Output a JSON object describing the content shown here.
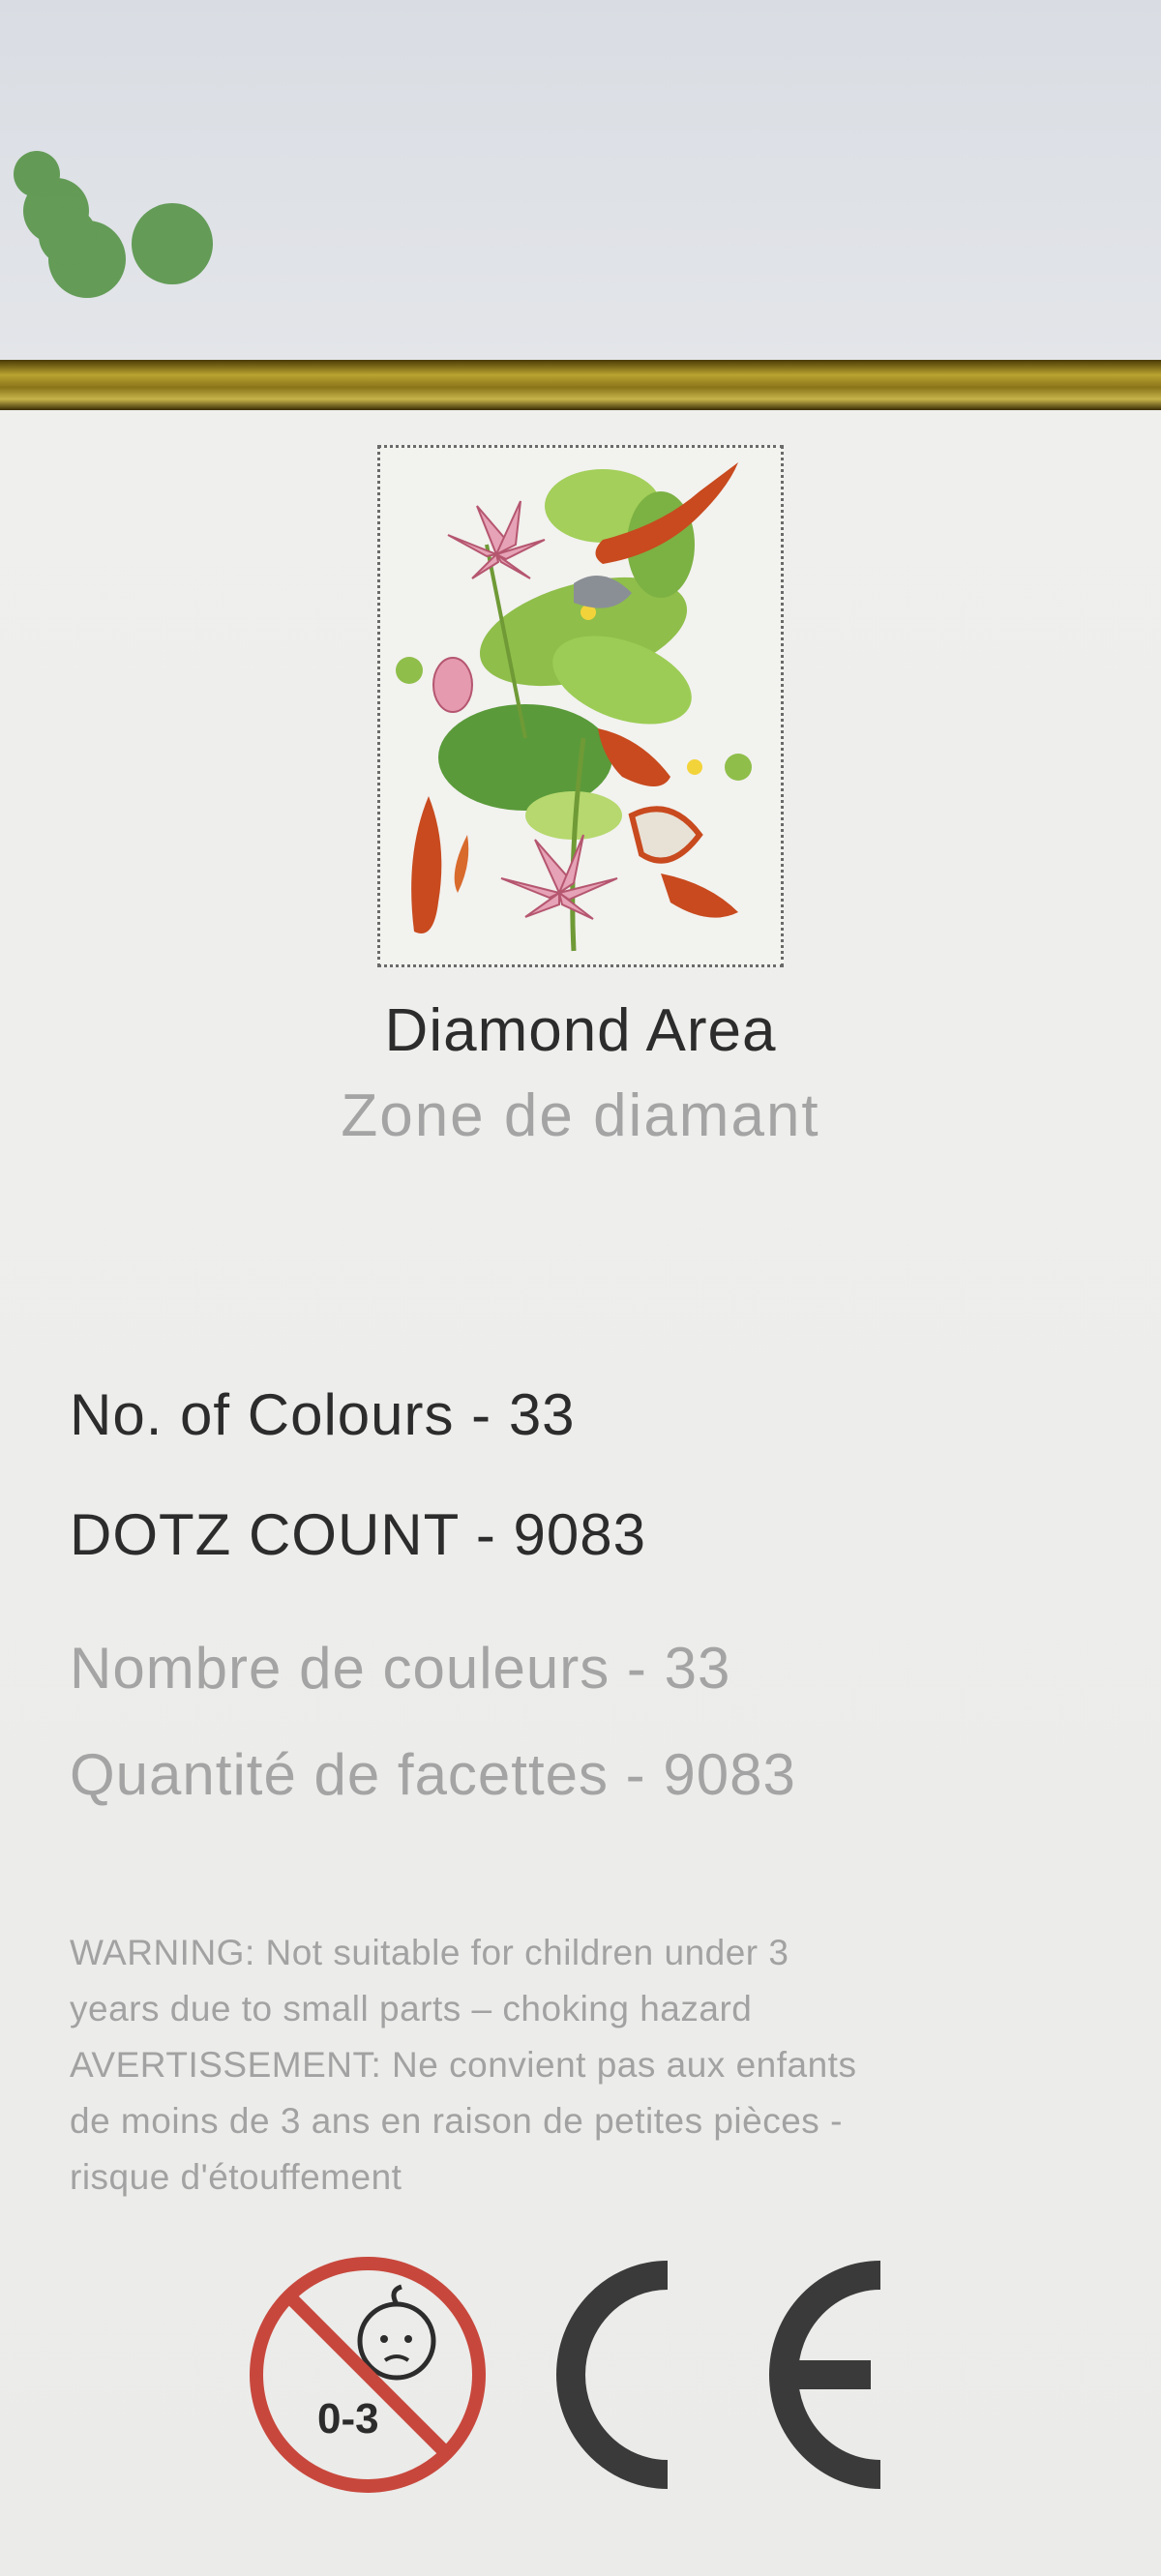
{
  "artwork": {
    "icon": "lotus-koi-artwork-icon"
  },
  "title": {
    "en": "Diamond Area",
    "fr": "Zone de diamant"
  },
  "specs": {
    "colours_en": "No. of Colours - 33",
    "count_en": "DOTZ COUNT - 9083",
    "colours_fr": "Nombre de couleurs  - 33",
    "count_fr": "Quantité de facettes  - 9083"
  },
  "warning": {
    "lines": [
      "WARNING: Not suitable for children under 3",
      "years due to small parts – choking hazard",
      "AVERTISSEMENT: Ne convient pas aux enfants",
      "de moins de 3 ans en raison de petites pièces -",
      "risque d'étouffement"
    ]
  },
  "age_symbol": {
    "label": "0-3",
    "icon": "no-under-3-icon"
  },
  "ce_mark": {
    "icon": "ce-mark-icon"
  },
  "colors": {
    "gold": "#b9a331",
    "red_circle": "#c8473c",
    "green_dots": "#4e8f3e",
    "text_dark": "#2c2c2c",
    "text_light": "#a4a4a4"
  }
}
